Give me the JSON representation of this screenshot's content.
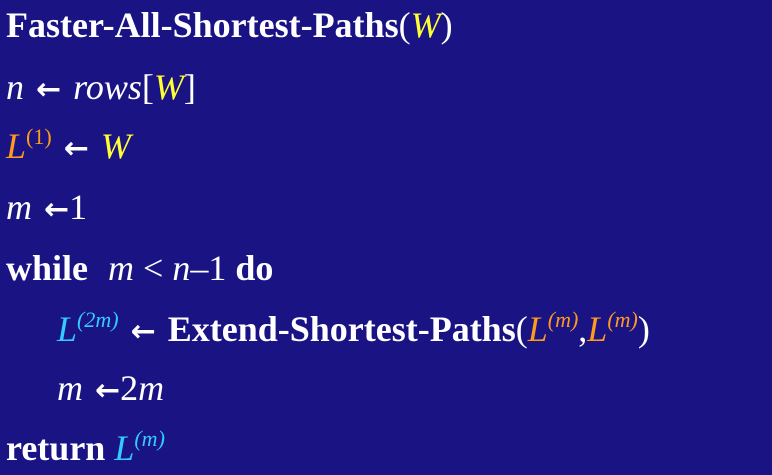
{
  "lines": {
    "l1": {
      "func_name": "Faster-All-Shortest-Paths",
      "paren_open": "(",
      "arg": "W",
      "paren_close": ")"
    },
    "l2": {
      "var": "n",
      "arrow": "←",
      "expr": "rows",
      "bracket_open": "[",
      "arg": "W",
      "bracket_close": "]"
    },
    "l3": {
      "var": "L",
      "sup": "(1)",
      "arrow": "←",
      "value": "W"
    },
    "l4": {
      "var": "m",
      "arrow": "←",
      "value": "1"
    },
    "l5": {
      "kw_while": "while",
      "m": "m",
      "lt": "<",
      "n": "n",
      "minus": "–",
      "one": "1",
      "kw_do": "do"
    },
    "l6": {
      "var": "L",
      "sup": "(2m)",
      "arrow": "←",
      "func_name": "Extend-Shortest-Paths",
      "paren_open": "(",
      "arg1": "L",
      "arg1_sup": "(m)",
      "comma": ",",
      "arg2": "L",
      "arg2_sup": "(m)",
      "paren_close": ")"
    },
    "l7": {
      "var": "m",
      "arrow": "←",
      "coef": "2",
      "m": "m"
    },
    "l8": {
      "kw_return": "return",
      "var": "L",
      "sup": "(m)"
    }
  },
  "colors": {
    "background": "#1a1384",
    "text": "#ffffff",
    "yellow_arg": "#ffff33",
    "orange_var": "#ff9a1f",
    "cyan_var": "#33ccff"
  }
}
